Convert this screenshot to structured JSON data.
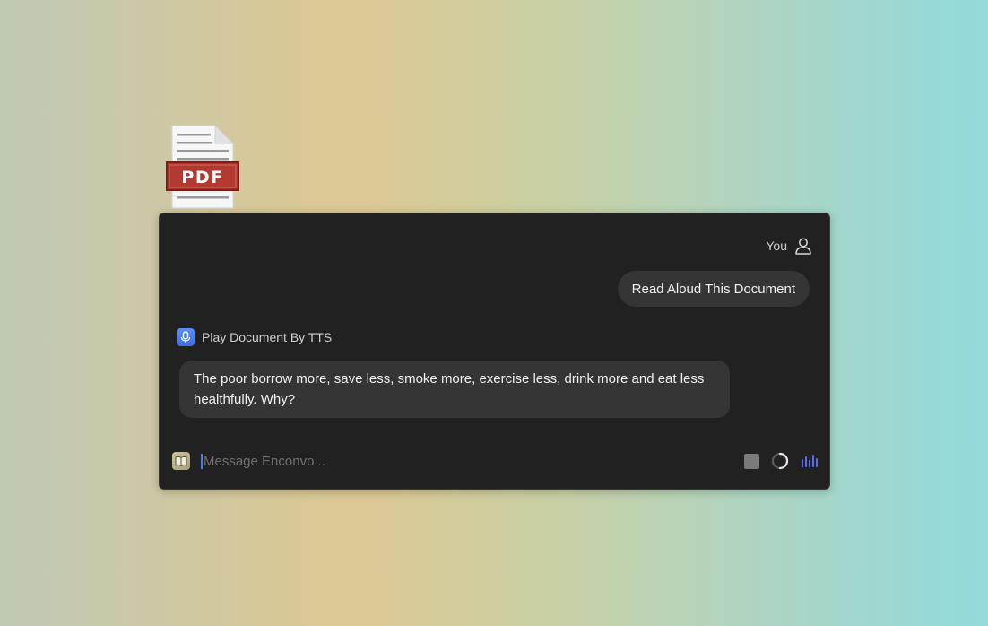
{
  "file": {
    "icon": "pdf-file-icon",
    "badge": "PDF"
  },
  "chat": {
    "user": {
      "name": "You",
      "icon": "user-icon",
      "message": "Read Aloud This Document"
    },
    "bot": {
      "name": "Play Document By TTS",
      "icon": "microphone-icon",
      "message": "The poor borrow more, save less, smoke more, exercise less, drink more and eat less healthfully. Why?"
    },
    "input": {
      "placeholder": "Message Enconvo...",
      "value": "",
      "left_icon": "book-icon"
    },
    "controls": {
      "stop": "stop-icon",
      "loading": "spinner-icon",
      "voice": "voice-wave-icon"
    },
    "colors": {
      "window_bg": "#212121",
      "bubble_bg": "#353535",
      "accent": "#5b6cf0",
      "caret": "#4a7cf0"
    }
  }
}
